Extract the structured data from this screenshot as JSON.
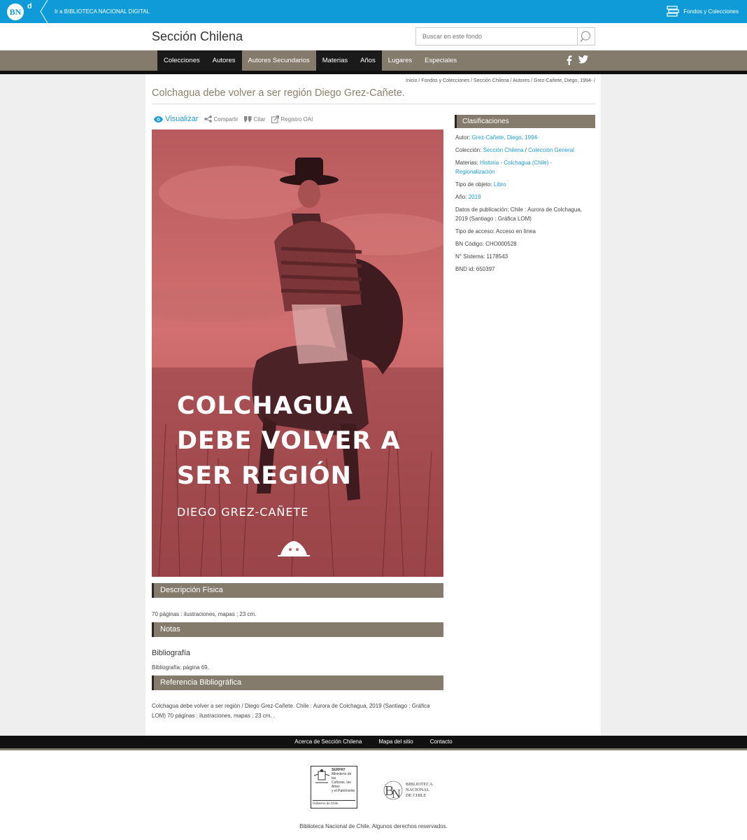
{
  "topbar": {
    "logo_text": "BN",
    "logo_d": "d",
    "link_label": "Ir a BIBLIOTECA NACIONAL DIGITAL",
    "fondos_label": "Fondos y Colecciones"
  },
  "header": {
    "site_title": "Sección Chilena",
    "search_placeholder": "Buscar en este fondo"
  },
  "nav": {
    "items": [
      {
        "label": "Colecciones",
        "dark": true
      },
      {
        "label": "Autores",
        "dark": true
      },
      {
        "label": "Autores Secundarios",
        "dark": false
      },
      {
        "label": "Materias",
        "dark": true
      },
      {
        "label": "Años",
        "dark": true
      },
      {
        "label": "Lugares",
        "dark": false
      },
      {
        "label": "Especiales",
        "dark": false
      }
    ]
  },
  "breadcrumb": [
    "Inicio",
    "Fondos y Colecciones",
    "Sección Chilena",
    "Autores",
    "Grez-Cañete, Diego, 1994-"
  ],
  "record": {
    "title": "Colchagua debe volver a ser región Diego Grez-Cañete.",
    "actions": {
      "visualizar": "Visualizar",
      "compartir": "Compartir",
      "citar": "Citar",
      "registro": "Registro OAI"
    },
    "cover": {
      "title_lines": [
        "COLCHAGUA",
        "DEBE VOLVER A",
        "SER REGIÓN"
      ],
      "author": "DIEGO GREZ-CAÑETE",
      "color": "#c46164"
    }
  },
  "sections": {
    "descripcion_title": "Descripción Física",
    "descripcion_text": "70 páginas : ilustraciones, mapas ; 23 cm.",
    "notas_title": "Notas",
    "notas_sub": "Bibliografía",
    "notas_text": "Bibliografía: página 69.",
    "referencia_title": "Referencia Bibliográfica",
    "referencia_text_1": "Colchagua debe volver a ser región / Diego Grez-Cañete. Chile : Aurora de Colchagua, 2019 (Santiago : Gráfica",
    "referencia_text_2": "LOM) 70 páginas : ilustraciones, mapas ; 23 cm. ."
  },
  "sidebar": {
    "title": "Clasificaciones",
    "autor_label": "Autor:",
    "autor_value": "Grez-Cañete, Diego, 1994-",
    "coleccion_label": "Colección:",
    "coleccion_1": "Sección Chilena",
    "coleccion_sep": "/",
    "coleccion_2": "Colección General",
    "materias_label": "Materias:",
    "materias_1": "Historia - Colchagua (Chile) -",
    "materias_2": "Regionalización",
    "tipo_label": "Tipo de objeto:",
    "tipo_value": "Libro",
    "anio_label": "Año:",
    "anio_value": "2019",
    "datos_pub": "Datos de publicación: Chile : Aurora de Colchagua, 2019 (Santiago : Gráfica LOM)",
    "acceso": "Tipo de acceso: Acceso en línea",
    "bn_codigo": "BN Código: CHO000528",
    "sistema": "N° Sistema: 1178543",
    "bnd_id": "BND id: 650397"
  },
  "footer": {
    "links": [
      "Acerca de Sección Chilena",
      "Mapa del sitio",
      "Contacto"
    ],
    "serpat_title": "SERPAT",
    "serpat_sub_1": "Ministerio de las",
    "serpat_sub_2": "Culturas, las Artes",
    "serpat_sub_3": "y el Patrimonio",
    "serpat_gob": "Gobierno de Chile",
    "bnc_line_1": "BIBLIOTECA",
    "bnc_line_2": "NACIONAL",
    "bnc_line_3": "DE CHILE",
    "copyright": "Biblioteca Nacional de Chile. Algunos derechos reservados."
  },
  "colors": {
    "accent_blue": "#0f9bd7",
    "nav_brown": "#857b6d",
    "link_blue": "#1e9bd7"
  }
}
